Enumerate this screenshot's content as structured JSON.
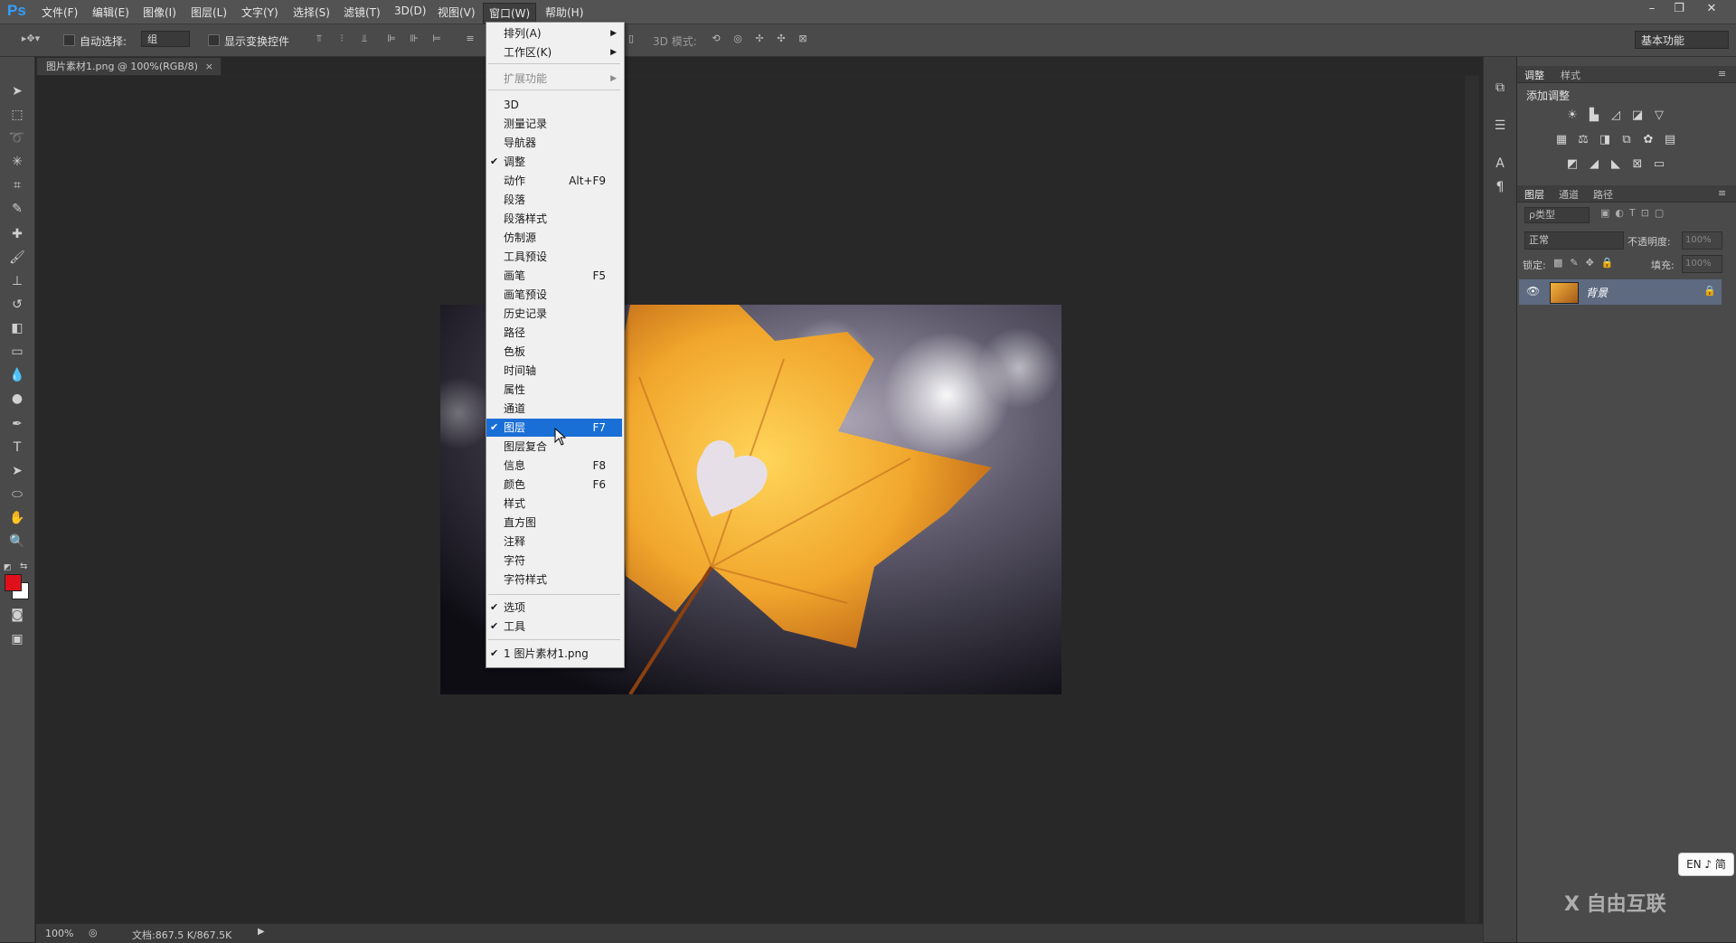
{
  "app": {
    "logo": "Ps"
  },
  "menubar": {
    "items": [
      "文件(F)",
      "编辑(E)",
      "图像(I)",
      "图层(L)",
      "文字(Y)",
      "选择(S)",
      "滤镜(T)",
      "3D(D)",
      "视图(V)",
      "窗口(W)",
      "帮助(H)"
    ],
    "active": "窗口(W)"
  },
  "window_controls": {
    "minimize": "–",
    "restore": "❐",
    "close": "✕"
  },
  "options": {
    "auto_select_label": "自动选择:",
    "auto_select_value": "组",
    "show_transform_label": "显示变换控件",
    "mode3d_label": "3D 模式:",
    "workspace": "基本功能"
  },
  "document": {
    "tab_title": "图片素材1.png @ 100%(RGB/8)",
    "tab_close": "×"
  },
  "status": {
    "zoom": "100%",
    "doc_info": "文档:867.5 K/867.5K"
  },
  "window_menu": {
    "arrange": "排列(A)",
    "workspace": "工作区(K)",
    "extensions": "扩展功能",
    "panels": [
      {
        "label": "3D",
        "shortcut": "",
        "checked": false
      },
      {
        "label": "测量记录",
        "shortcut": "",
        "checked": false
      },
      {
        "label": "导航器",
        "shortcut": "",
        "checked": false
      },
      {
        "label": "调整",
        "shortcut": "",
        "checked": true
      },
      {
        "label": "动作",
        "shortcut": "Alt+F9",
        "checked": false
      },
      {
        "label": "段落",
        "shortcut": "",
        "checked": false
      },
      {
        "label": "段落样式",
        "shortcut": "",
        "checked": false
      },
      {
        "label": "仿制源",
        "shortcut": "",
        "checked": false
      },
      {
        "label": "工具预设",
        "shortcut": "",
        "checked": false
      },
      {
        "label": "画笔",
        "shortcut": "F5",
        "checked": false
      },
      {
        "label": "画笔预设",
        "shortcut": "",
        "checked": false
      },
      {
        "label": "历史记录",
        "shortcut": "",
        "checked": false
      },
      {
        "label": "路径",
        "shortcut": "",
        "checked": false
      },
      {
        "label": "色板",
        "shortcut": "",
        "checked": false
      },
      {
        "label": "时间轴",
        "shortcut": "",
        "checked": false
      },
      {
        "label": "属性",
        "shortcut": "",
        "checked": false
      },
      {
        "label": "通道",
        "shortcut": "",
        "checked": false
      },
      {
        "label": "图层",
        "shortcut": "F7",
        "checked": true,
        "highlighted": true
      },
      {
        "label": "图层复合",
        "shortcut": "",
        "checked": false
      },
      {
        "label": "信息",
        "shortcut": "F8",
        "checked": false
      },
      {
        "label": "颜色",
        "shortcut": "F6",
        "checked": false
      },
      {
        "label": "样式",
        "shortcut": "",
        "checked": false
      },
      {
        "label": "直方图",
        "shortcut": "",
        "checked": false
      },
      {
        "label": "注释",
        "shortcut": "",
        "checked": false
      },
      {
        "label": "字符",
        "shortcut": "",
        "checked": false
      },
      {
        "label": "字符样式",
        "shortcut": "",
        "checked": false
      }
    ],
    "options_item": "选项",
    "tools_item": "工具",
    "recent_doc": "1 图片素材1.png"
  },
  "panels": {
    "adjust_tabs": [
      "调整",
      "样式"
    ],
    "add_adjustment": "添加调整",
    "layer_tabs": [
      "图层",
      "通道",
      "路径"
    ],
    "filter_kind": "ρ类型",
    "blend_mode": "正常",
    "opacity_label": "不透明度:",
    "opacity_value": "100%",
    "lock_label": "锁定:",
    "fill_label": "填充:",
    "fill_value": "100%",
    "layer_name": "背景"
  },
  "ime": "EN ♪ 简",
  "watermark": "X 自由互联",
  "colors": {
    "foreground": "#e0101a",
    "background": "#ffffff",
    "selection": "#1a6fd6"
  }
}
